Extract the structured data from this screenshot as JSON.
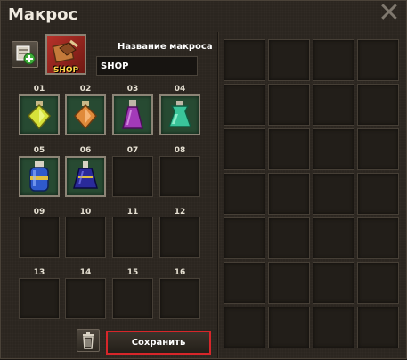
{
  "window": {
    "title": "Макрос",
    "close_glyph": "✕"
  },
  "macro": {
    "icon": "shop-icon",
    "icon_caption": "SHOP",
    "name_label": "Название макроса",
    "name_value": "SHOP"
  },
  "slots": [
    {
      "num": "01",
      "item": "yellow-potion"
    },
    {
      "num": "02",
      "item": "orange-potion"
    },
    {
      "num": "03",
      "item": "purple-potion"
    },
    {
      "num": "04",
      "item": "green-potion"
    },
    {
      "num": "05",
      "item": "blue-potion"
    },
    {
      "num": "06",
      "item": "dark-blue-potion"
    },
    {
      "num": "07",
      "item": null
    },
    {
      "num": "08",
      "item": null
    },
    {
      "num": "09",
      "item": null
    },
    {
      "num": "10",
      "item": null
    },
    {
      "num": "11",
      "item": null
    },
    {
      "num": "12",
      "item": null
    },
    {
      "num": "13",
      "item": null
    },
    {
      "num": "14",
      "item": null
    },
    {
      "num": "15",
      "item": null
    },
    {
      "num": "16",
      "item": null
    }
  ],
  "actions": {
    "save_label": "Сохранить",
    "delete_icon": "trash-icon"
  },
  "colors": {
    "accent_border": "#d7262a",
    "slot_background": "#274a32"
  }
}
